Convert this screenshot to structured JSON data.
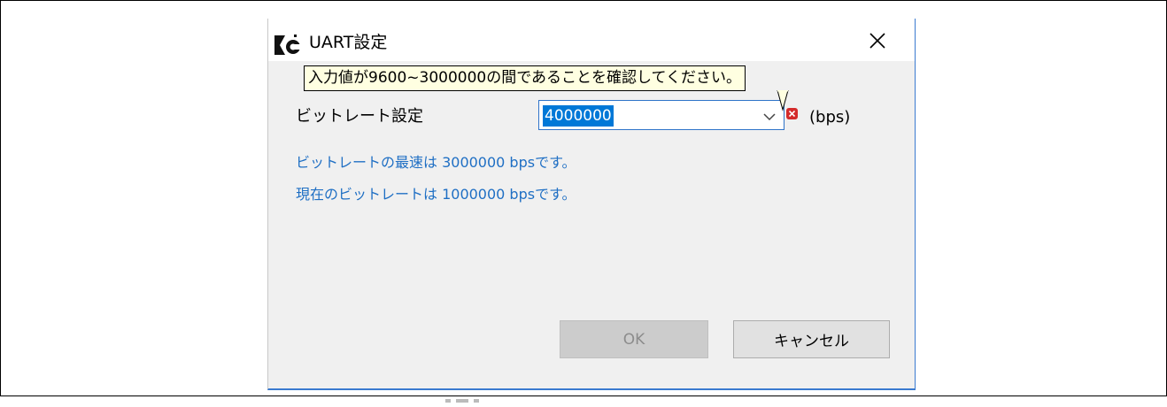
{
  "window": {
    "title": "UART設定",
    "close_glyph": "✕"
  },
  "tooltip": {
    "text": "入力値が9600~3000000の間であることを確認してください。"
  },
  "form": {
    "bitrate_label": "ビットレート設定",
    "bitrate_value": "4000000",
    "unit": "(bps)"
  },
  "info": {
    "max_rate": "ビットレートの最速は 3000000 bpsです。",
    "current_rate": "現在のビットレートは 1000000 bpsです。"
  },
  "buttons": {
    "ok": "OK",
    "cancel": "キャンセル"
  },
  "colors": {
    "dialog_bg": "#f0f0f0",
    "accent_border": "#3a7ad0",
    "selection": "#0078d7",
    "info_text": "#1f6fc4",
    "error": "#d42b2b",
    "tooltip_bg": "#ffffe1"
  },
  "icons": {
    "app": "app-logo-icon",
    "close": "close-icon",
    "dropdown": "chevron-down-icon",
    "error": "error-icon"
  }
}
